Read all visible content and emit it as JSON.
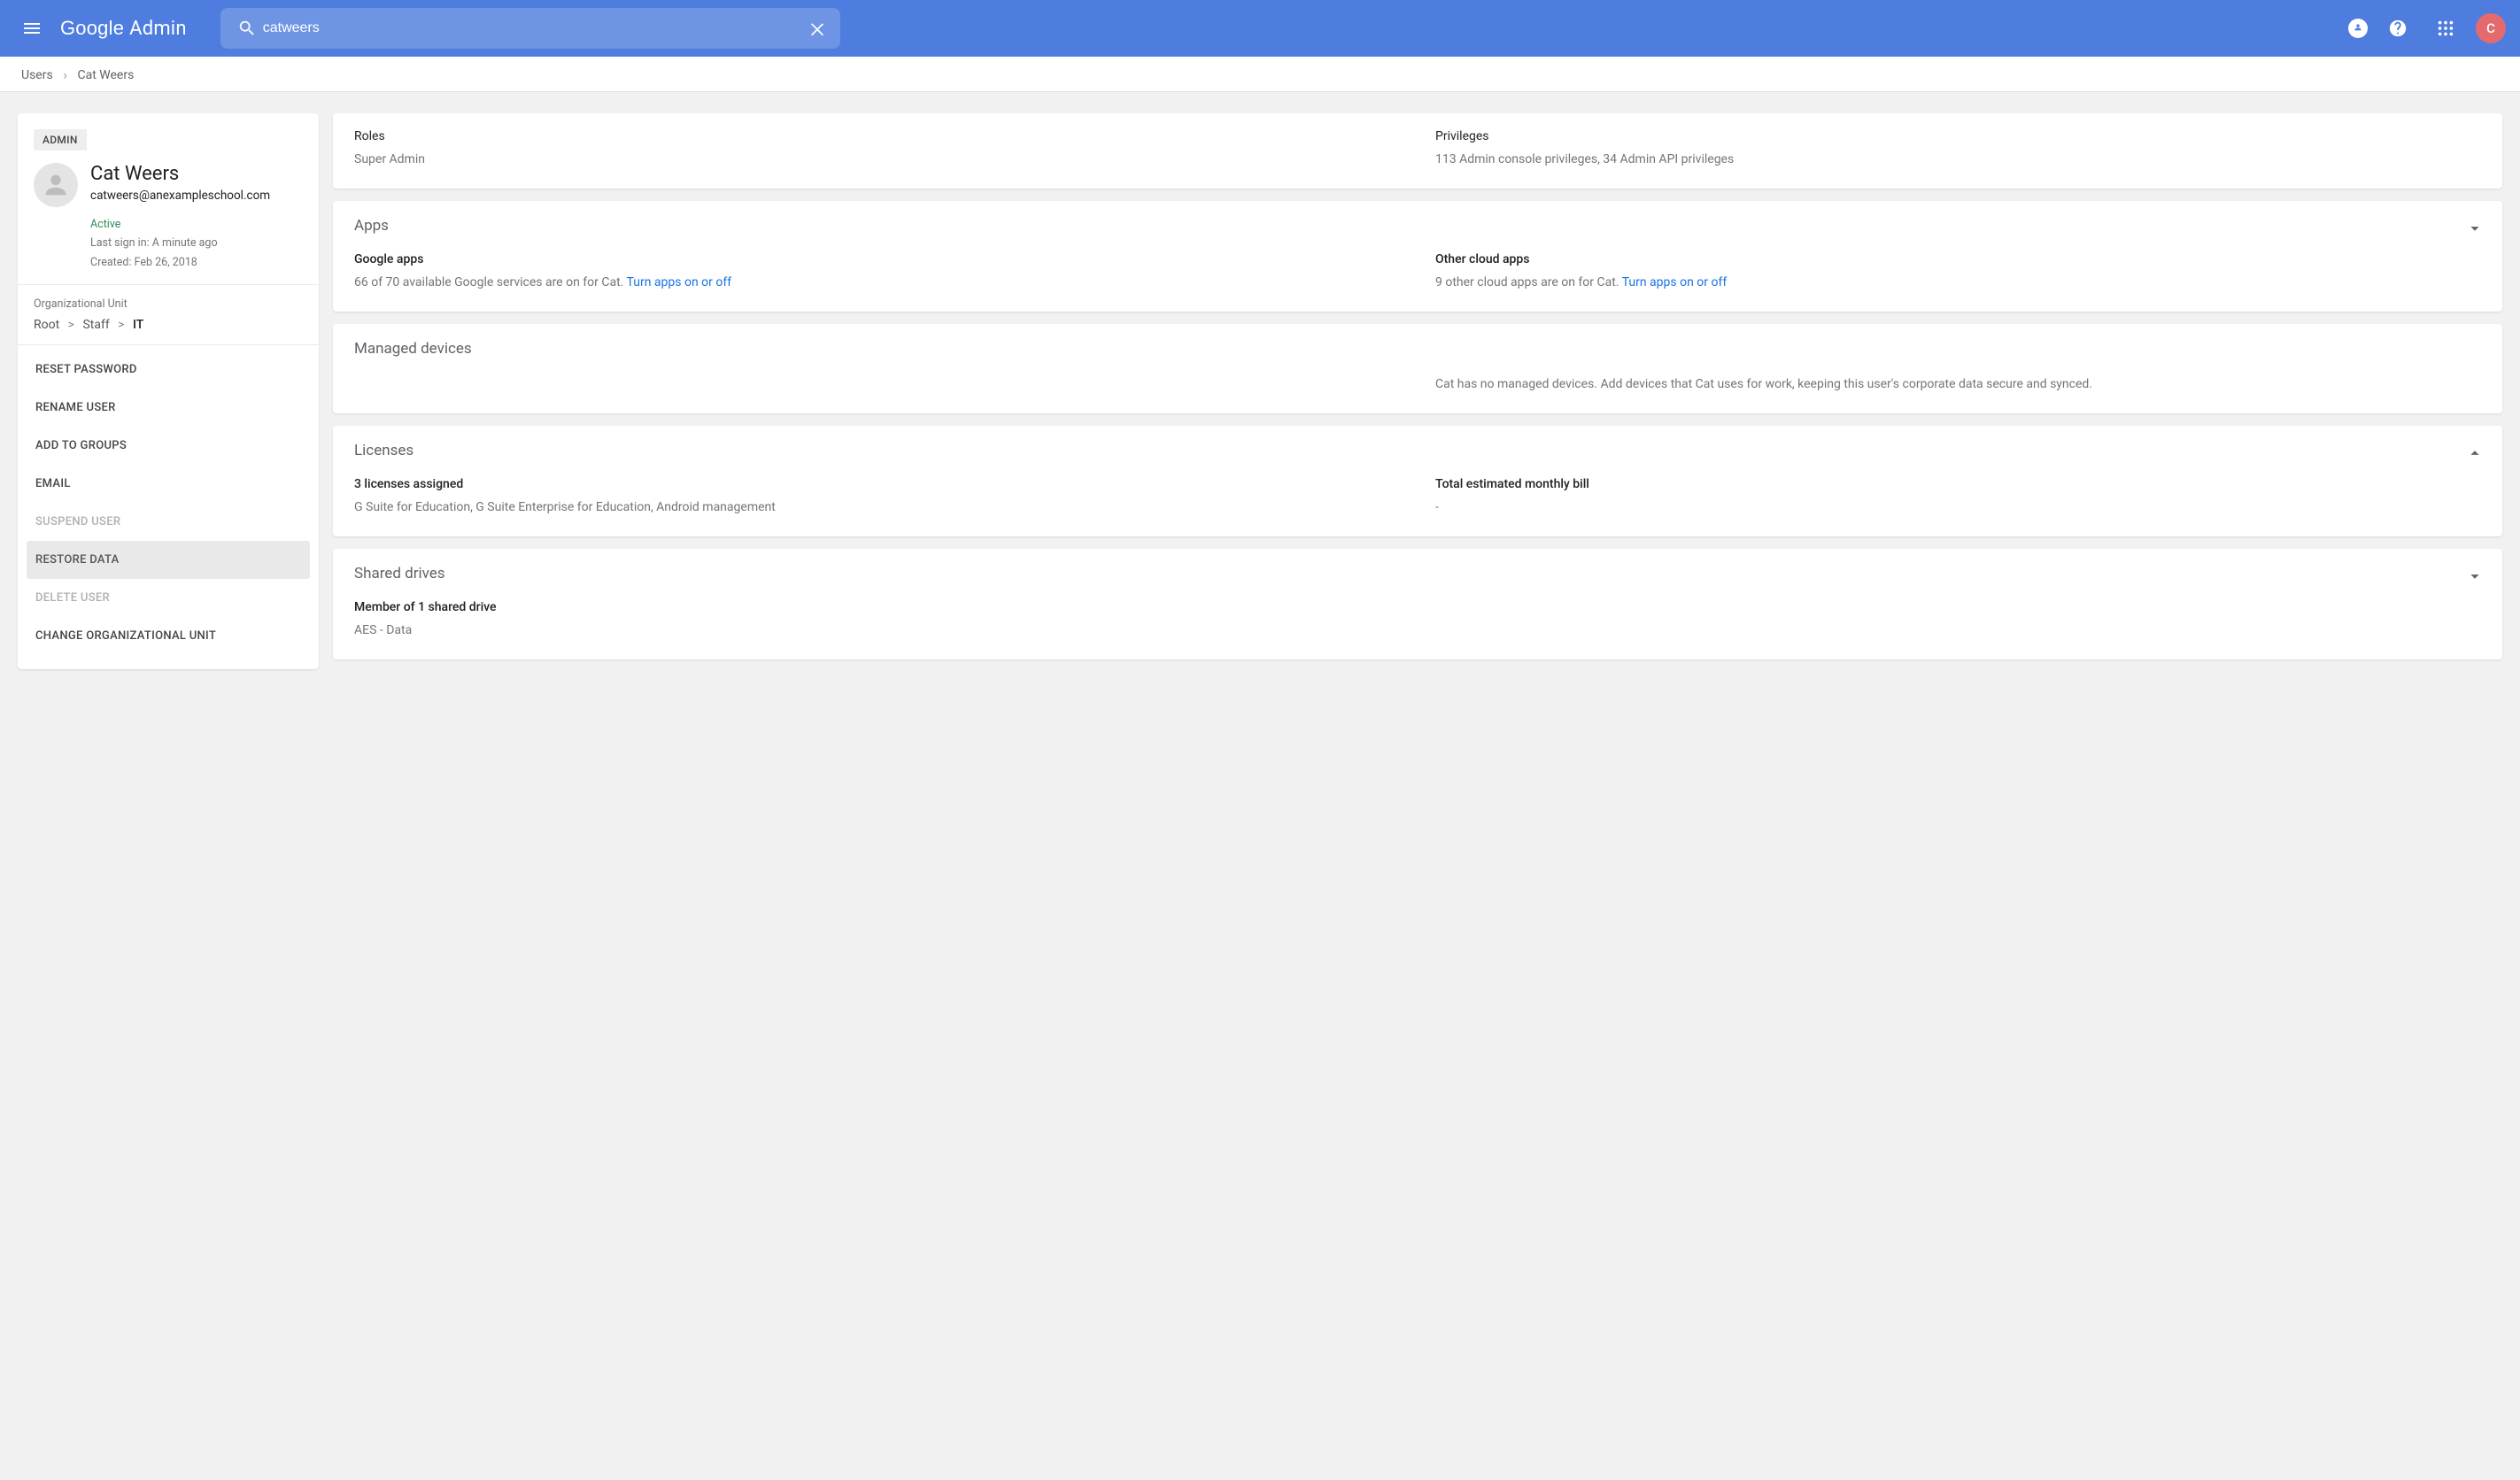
{
  "header": {
    "logo_left": "Google",
    "logo_right": "Admin",
    "search_value": "catweers",
    "avatar_initial": "C"
  },
  "breadcrumb": {
    "root": "Users",
    "leaf": "Cat Weers"
  },
  "sidebar": {
    "admin_badge": "ADMIN",
    "name": "Cat Weers",
    "email": "catweers@anexampleschool.com",
    "status": "Active",
    "last_signin": "Last sign in: A minute ago",
    "created": "Created: Feb 26, 2018",
    "ou_label": "Organizational Unit",
    "ou_path": {
      "a": "Root",
      "b": "Staff",
      "c": "IT"
    },
    "actions": {
      "reset_password": "RESET PASSWORD",
      "rename_user": "RENAME USER",
      "add_to_groups": "ADD TO GROUPS",
      "email": "EMAIL",
      "suspend_user": "SUSPEND USER",
      "restore_data": "RESTORE DATA",
      "delete_user": "DELETE USER",
      "change_ou": "CHANGE ORGANIZATIONAL UNIT"
    }
  },
  "cards": {
    "roles": {
      "roles_label": "Roles",
      "roles_value": "Super Admin",
      "priv_label": "Privileges",
      "priv_value": "113 Admin console privileges, 34 Admin API privileges"
    },
    "apps": {
      "title": "Apps",
      "google_label": "Google apps",
      "google_text": "66 of 70 available Google services are on for Cat.",
      "google_link": "Turn apps on or off",
      "other_label": "Other cloud apps",
      "other_text": "9 other cloud apps are on for Cat.",
      "other_link": "Turn apps on or off"
    },
    "devices": {
      "title": "Managed devices",
      "text": "Cat has no managed devices. Add devices that Cat uses for work, keeping this user's corporate data secure and synced."
    },
    "licenses": {
      "title": "Licenses",
      "count_label": "3 licenses assigned",
      "count_text": "G Suite for Education, G Suite Enterprise for Education, Android management",
      "bill_label": "Total estimated monthly bill",
      "bill_value": "-"
    },
    "drives": {
      "title": "Shared drives",
      "member_label": "Member of 1 shared drive",
      "member_text": "AES - Data"
    }
  }
}
